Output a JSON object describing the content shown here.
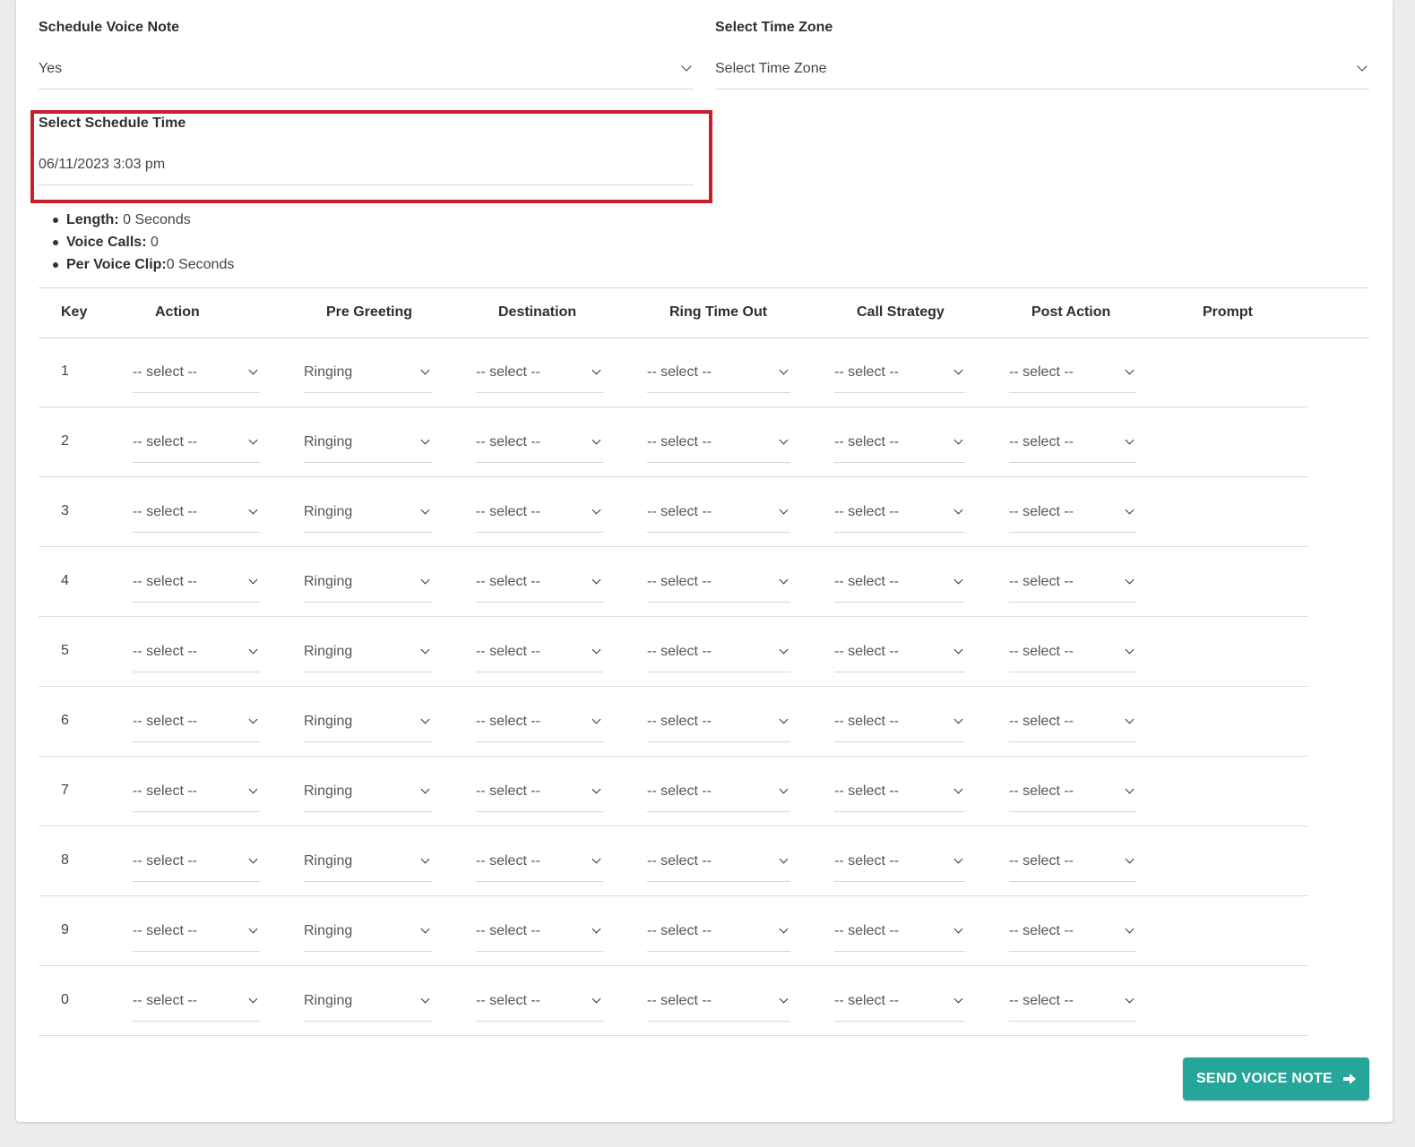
{
  "schedule_voice_note": {
    "label": "Schedule Voice Note",
    "value": "Yes"
  },
  "time_zone": {
    "label": "Select Time Zone",
    "value": "Select Time Zone"
  },
  "schedule_time": {
    "label": "Select Schedule Time",
    "value": "06/11/2023 3:03 pm"
  },
  "stats": [
    {
      "label": "Length:",
      "value": " 0 Seconds"
    },
    {
      "label": "Voice Calls:",
      "value": " 0"
    },
    {
      "label": "Per Voice Clip:",
      "value": "0 Seconds"
    }
  ],
  "table": {
    "headers": [
      "Key",
      "Action",
      "Pre Greeting",
      "Destination",
      "Ring Time Out",
      "Call Strategy",
      "Post Action",
      "Prompt"
    ],
    "rows": [
      {
        "key": "1",
        "action": "-- select --",
        "pre_greeting": "Ringing",
        "destination": "-- select --",
        "ring_time_out": "-- select --",
        "call_strategy": "-- select --",
        "post_action": "-- select --"
      },
      {
        "key": "2",
        "action": "-- select --",
        "pre_greeting": "Ringing",
        "destination": "-- select --",
        "ring_time_out": "-- select --",
        "call_strategy": "-- select --",
        "post_action": "-- select --"
      },
      {
        "key": "3",
        "action": "-- select --",
        "pre_greeting": "Ringing",
        "destination": "-- select --",
        "ring_time_out": "-- select --",
        "call_strategy": "-- select --",
        "post_action": "-- select --"
      },
      {
        "key": "4",
        "action": "-- select --",
        "pre_greeting": "Ringing",
        "destination": "-- select --",
        "ring_time_out": "-- select --",
        "call_strategy": "-- select --",
        "post_action": "-- select --"
      },
      {
        "key": "5",
        "action": "-- select --",
        "pre_greeting": "Ringing",
        "destination": "-- select --",
        "ring_time_out": "-- select --",
        "call_strategy": "-- select --",
        "post_action": "-- select --"
      },
      {
        "key": "6",
        "action": "-- select --",
        "pre_greeting": "Ringing",
        "destination": "-- select --",
        "ring_time_out": "-- select --",
        "call_strategy": "-- select --",
        "post_action": "-- select --"
      },
      {
        "key": "7",
        "action": "-- select --",
        "pre_greeting": "Ringing",
        "destination": "-- select --",
        "ring_time_out": "-- select --",
        "call_strategy": "-- select --",
        "post_action": "-- select --"
      },
      {
        "key": "8",
        "action": "-- select --",
        "pre_greeting": "Ringing",
        "destination": "-- select --",
        "ring_time_out": "-- select --",
        "call_strategy": "-- select --",
        "post_action": "-- select --"
      },
      {
        "key": "9",
        "action": "-- select --",
        "pre_greeting": "Ringing",
        "destination": "-- select --",
        "ring_time_out": "-- select --",
        "call_strategy": "-- select --",
        "post_action": "-- select --"
      },
      {
        "key": "0",
        "action": "-- select --",
        "pre_greeting": "Ringing",
        "destination": "-- select --",
        "ring_time_out": "-- select --",
        "call_strategy": "-- select --",
        "post_action": "-- select --"
      }
    ]
  },
  "send_button": {
    "label": "SEND VOICE NOTE",
    "icon": "arrow-right-icon",
    "color": "#26a69a"
  },
  "highlight_color": "#c8202a"
}
